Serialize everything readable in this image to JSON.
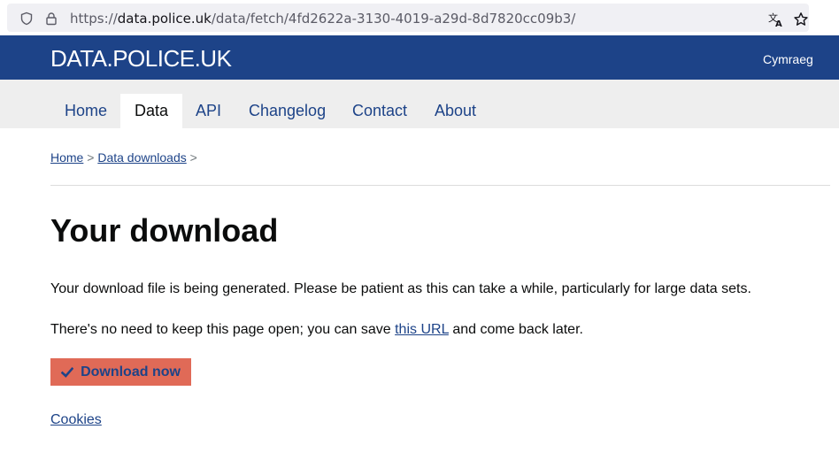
{
  "browser": {
    "url_prefix": "https://",
    "url_host": "data.police.uk",
    "url_path": "/data/fetch/4fd2622a-3130-4019-a29d-8d7820cc09b3/",
    "icons": [
      "shield-icon",
      "lock-icon",
      "translate-icon",
      "bookmark-star-icon"
    ]
  },
  "header": {
    "logo": "DATA.POLICE.UK",
    "language_link": "Cymraeg"
  },
  "nav": {
    "items": [
      {
        "label": "Home"
      },
      {
        "label": "Data"
      },
      {
        "label": "API"
      },
      {
        "label": "Changelog"
      },
      {
        "label": "Contact"
      },
      {
        "label": "About"
      }
    ],
    "active": "Data"
  },
  "breadcrumb": {
    "items": [
      "Home",
      "Data downloads"
    ],
    "separator": ">"
  },
  "main": {
    "title": "Your download",
    "para1": "Your download file is being generated. Please be patient as this can take a while, particularly for large data sets.",
    "para2_before": "There's no need to keep this page open; you can save ",
    "para2_link": "this URL",
    "para2_after": " and come back later.",
    "download_button": "Download now"
  },
  "footer": {
    "cookies_link": "Cookies"
  },
  "colors": {
    "brand_blue": "#1d4388",
    "button_bg": "#e06a57",
    "nav_bg": "#eeeeee"
  }
}
